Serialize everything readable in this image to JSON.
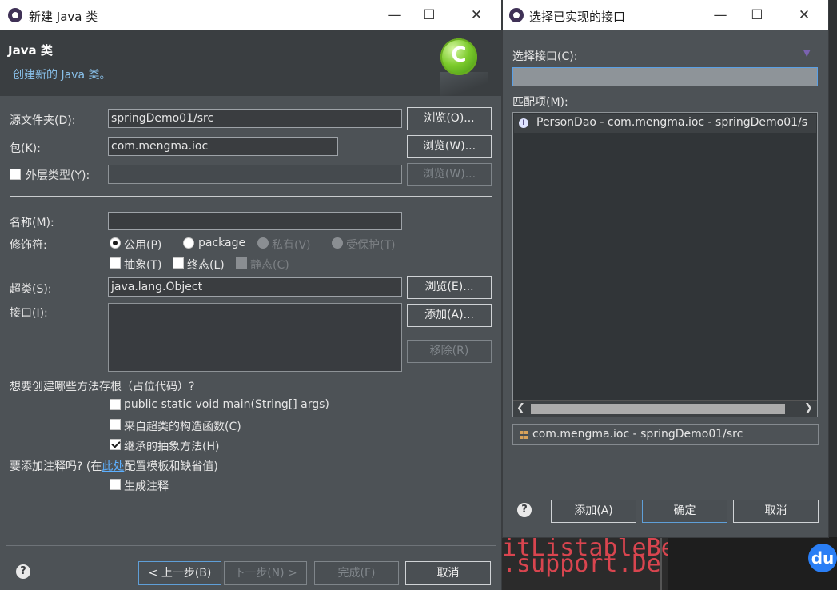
{
  "background_code": {
    "line1": "itListableBe",
    "line2": ".support.De"
  },
  "left_window": {
    "title": "新建 Java 类",
    "banner_title": "Java 类",
    "banner_subtitle": "创建新的 Java 类。",
    "source_folder": {
      "label": "源文件夹(D):",
      "value": "springDemo01/src",
      "browse": "浏览(O)..."
    },
    "package": {
      "label": "包(K):",
      "value": "com.mengma.ioc",
      "browse": "浏览(W)..."
    },
    "enclosing": {
      "label": "外层类型(Y):",
      "value": "",
      "checked": false,
      "browse": "浏览(W)..."
    },
    "name": {
      "label": "名称(M):",
      "value": ""
    },
    "modifiers": {
      "label": "修饰符:",
      "public": "公用(P)",
      "package": "package",
      "private": "私有(V)",
      "protected": "受保护(T)",
      "selected": "public",
      "abstract": "抽象(T)",
      "final": "终态(L)",
      "static": "静态(C)"
    },
    "superclass": {
      "label": "超类(S):",
      "value": "java.lang.Object",
      "browse": "浏览(E)..."
    },
    "interfaces": {
      "label": "接口(I):",
      "add": "添加(A)...",
      "remove": "移除(R)"
    },
    "stubs": {
      "question": "想要创建哪些方法存根（占位代码）?",
      "main": "public static void main(String[] args)",
      "constructors": "来自超类的构造函数(C)",
      "inherited": "继承的抽象方法(H)",
      "main_checked": false,
      "constructors_checked": false,
      "inherited_checked": true
    },
    "comments": {
      "question_prefix": "要添加注释吗?   (在",
      "link": "此处",
      "question_suffix": "配置模板和缺省值)",
      "generate": "生成注释",
      "generate_checked": false
    },
    "footer": {
      "back": "< 上一步(B)",
      "next": "下一步(N) >",
      "finish": "完成(F)",
      "cancel": "取消"
    }
  },
  "right_window": {
    "title": "选择已实现的接口",
    "select_label": "选择接口(C):",
    "select_value": "",
    "matches_label": "匹配项(M):",
    "matches": [
      {
        "icon": "interface-icon",
        "text": "PersonDao - com.mengma.ioc - springDemo01/s"
      }
    ],
    "package_status": "com.mengma.ioc - springDemo01/src",
    "buttons": {
      "add": "添加(A)",
      "ok": "确定",
      "cancel": "取消"
    }
  },
  "icons": {
    "help": "question-circle-icon",
    "java_logo": "java-class-logo-icon",
    "baidu": "baidu-du-icon"
  },
  "colors": {
    "dialog_bg": "#4d5256",
    "banner_bg": "#3a3e41",
    "link": "#5db0ff",
    "code_red": "#d9454f",
    "logo_green": "#7ccb2c"
  }
}
